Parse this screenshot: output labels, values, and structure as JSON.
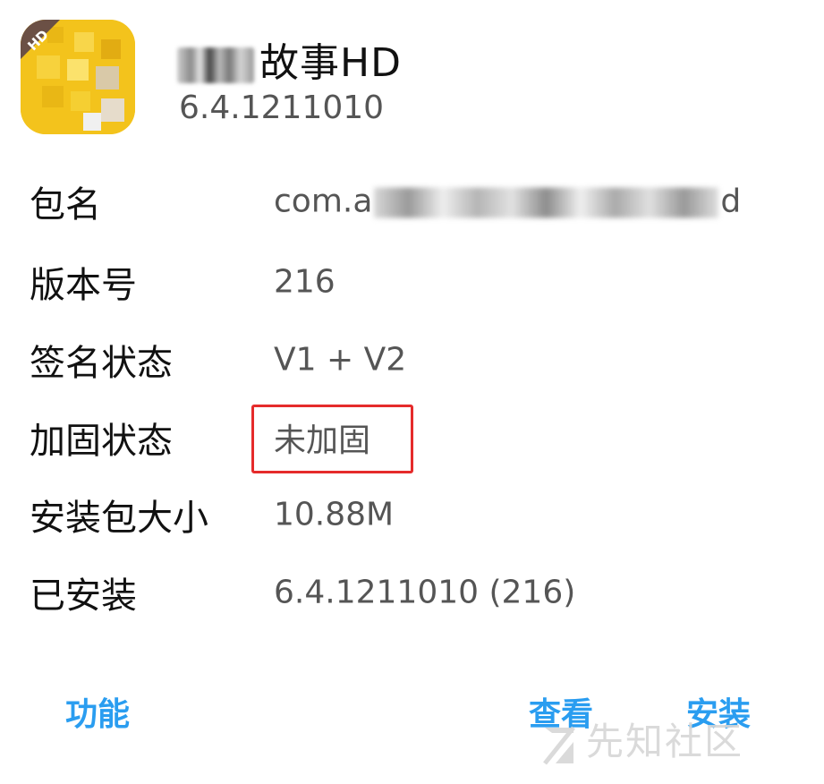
{
  "app": {
    "title_visible": "故事HD",
    "version": "6.4.1211010",
    "icon_badge": "HD"
  },
  "info": [
    {
      "label": "包名",
      "value_prefix": "com.a",
      "value_suffix": "d"
    },
    {
      "label": "版本号",
      "value": "216"
    },
    {
      "label": "签名状态",
      "value": "V1 + V2"
    },
    {
      "label": "加固状态",
      "value": "未加固"
    },
    {
      "label": "安装包大小",
      "value": "10.88M"
    },
    {
      "label": "已安装",
      "value": "6.4.1211010 (216)"
    }
  ],
  "actions": {
    "function_label": "功能",
    "view_label": "查看",
    "install_label": "安装"
  },
  "watermark": {
    "text": "先知社区"
  },
  "colors": {
    "accent": "#2a9df0",
    "highlight": "#e52b2b",
    "label": "#111111",
    "value": "#555555"
  }
}
